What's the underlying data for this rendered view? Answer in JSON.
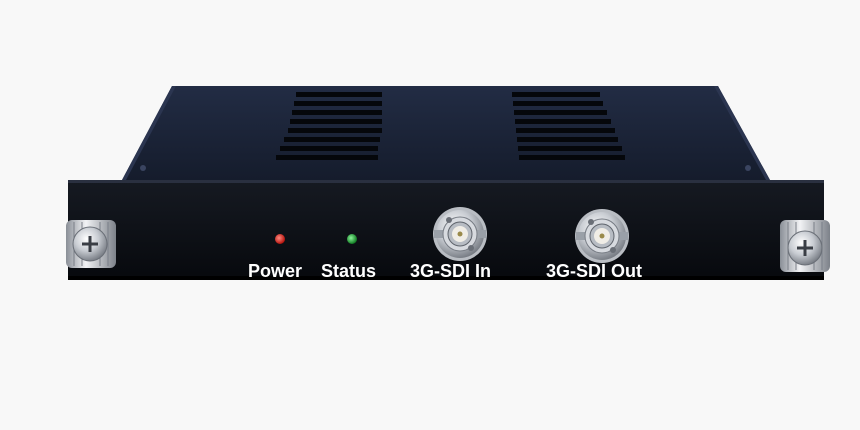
{
  "device": {
    "labels": {
      "power": "Power",
      "status": "Status",
      "sdi_in": "3G-SDI In",
      "sdi_out": "3G-SDI Out"
    },
    "leds": {
      "power_color": "#e0201a",
      "status_color": "#1fb032"
    },
    "colors": {
      "background": "#f8f8f8",
      "chassis_top": "#18223a",
      "faceplate": "#0c0f16",
      "label_text": "#ffffff",
      "metal": "#c9ccd1"
    },
    "icons": [
      "thumbscrew-icon",
      "bnc-connector-icon",
      "led-icon",
      "vent-icon"
    ]
  }
}
